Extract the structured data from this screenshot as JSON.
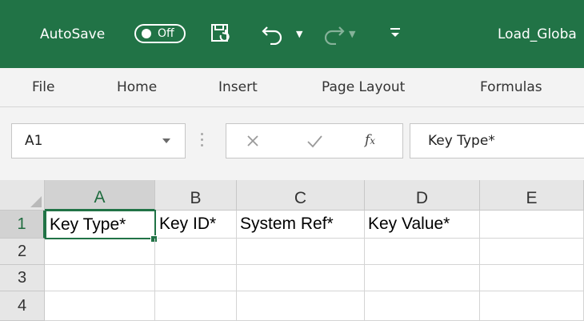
{
  "titlebar": {
    "autosave_label": "AutoSave",
    "autosave_state": "Off",
    "filename": "Load_Globa"
  },
  "ribbon": {
    "tabs": [
      "File",
      "Home",
      "Insert",
      "Page Layout",
      "Formulas"
    ]
  },
  "formula_bar": {
    "name_box": "A1",
    "formula": "Key Type*"
  },
  "grid": {
    "columns": [
      "A",
      "B",
      "C",
      "D",
      "E"
    ],
    "rows": [
      "1",
      "2",
      "3",
      "4"
    ],
    "cells": {
      "A1": "Key Type*",
      "B1": "Key ID*",
      "C1": "System Ref*",
      "D1": "Key Value*"
    },
    "selected_cell": "A1"
  },
  "colors": {
    "accent": "#217346",
    "header_bg": "#e6e6e6",
    "ribbon_bg": "#f3f3f3"
  },
  "icons": [
    "save-icon",
    "undo-icon",
    "redo-icon",
    "customize-qat-icon",
    "cancel-icon",
    "enter-icon",
    "function-icon"
  ]
}
